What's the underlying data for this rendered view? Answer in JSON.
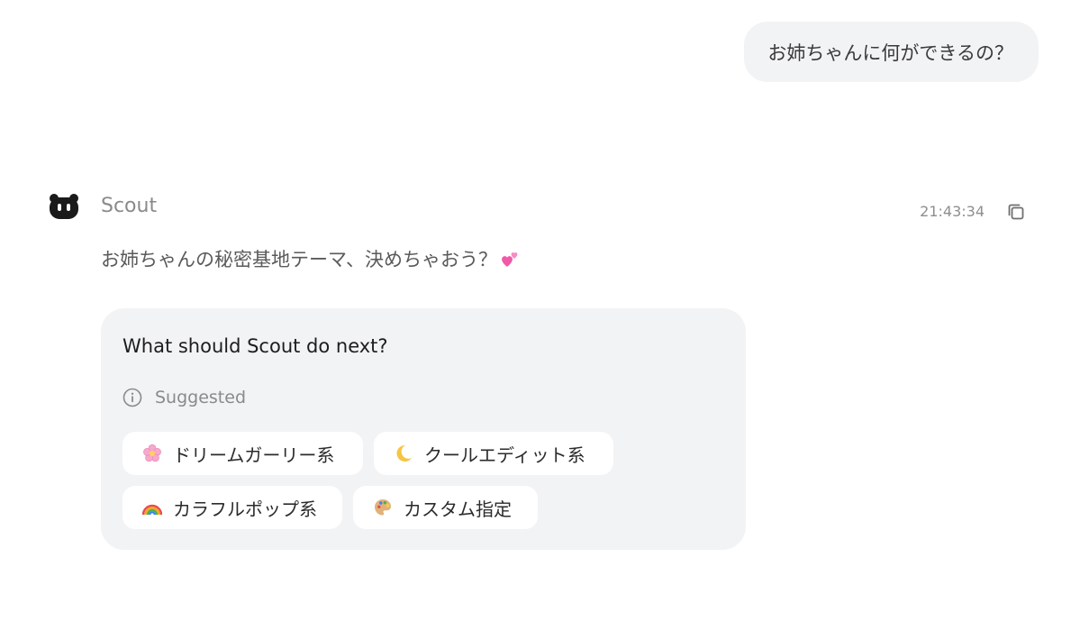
{
  "user_message": {
    "text": "お姉ちゃんに何ができるの？"
  },
  "assistant": {
    "name": "Scout",
    "avatar_icon": "paw-avatar-icon",
    "timestamp": "21:43:34",
    "copy_icon": "copy-icon",
    "message": "お姉ちゃんの秘密基地テーマ、決めちゃおう？",
    "message_emoji": "two-hearts-icon"
  },
  "action_card": {
    "title": "What should Scout do next?",
    "suggested_icon": "info-icon",
    "suggested_label": "Suggested",
    "options": [
      {
        "label": "ドリームガーリー系",
        "icon": "cherry-blossom-icon"
      },
      {
        "label": "クールエディット系",
        "icon": "crescent-moon-icon"
      },
      {
        "label": "カラフルポップ系",
        "icon": "rainbow-icon"
      },
      {
        "label": "カスタム指定",
        "icon": "palette-icon"
      }
    ]
  },
  "colors": {
    "bubble_bg": "#f2f3f5",
    "card_bg": "#f2f3f5",
    "chip_bg": "#ffffff",
    "muted_text": "#8a8a8a",
    "heart_pink": "#f05aa8"
  }
}
